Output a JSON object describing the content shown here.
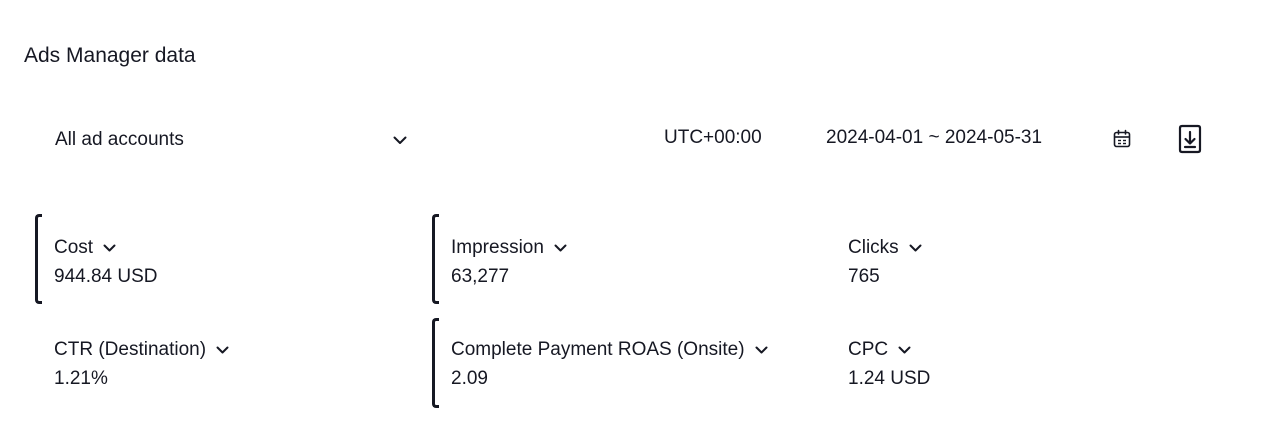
{
  "header": {
    "title": "Ads Manager data"
  },
  "filters": {
    "account_select": "All ad accounts",
    "timezone": "UTC+00:00",
    "date_range": "2024-04-01 ~ 2024-05-31"
  },
  "metrics": [
    {
      "label": "Cost",
      "value": "944.84 USD",
      "selected": true
    },
    {
      "label": "Impression",
      "value": "63,277",
      "selected": true
    },
    {
      "label": "Clicks",
      "value": "765",
      "selected": false
    },
    {
      "label": "CTR (Destination)",
      "value": "1.21%",
      "selected": false
    },
    {
      "label": "Complete Payment ROAS (Onsite)",
      "value": "2.09",
      "selected": true
    },
    {
      "label": "CPC",
      "value": "1.24 USD",
      "selected": false
    }
  ],
  "icons": {
    "account_dropdown": "chevron-down-icon",
    "calendar": "calendar-icon",
    "download": "download-icon"
  },
  "colors": {
    "text": "#161823",
    "background": "#ffffff"
  }
}
